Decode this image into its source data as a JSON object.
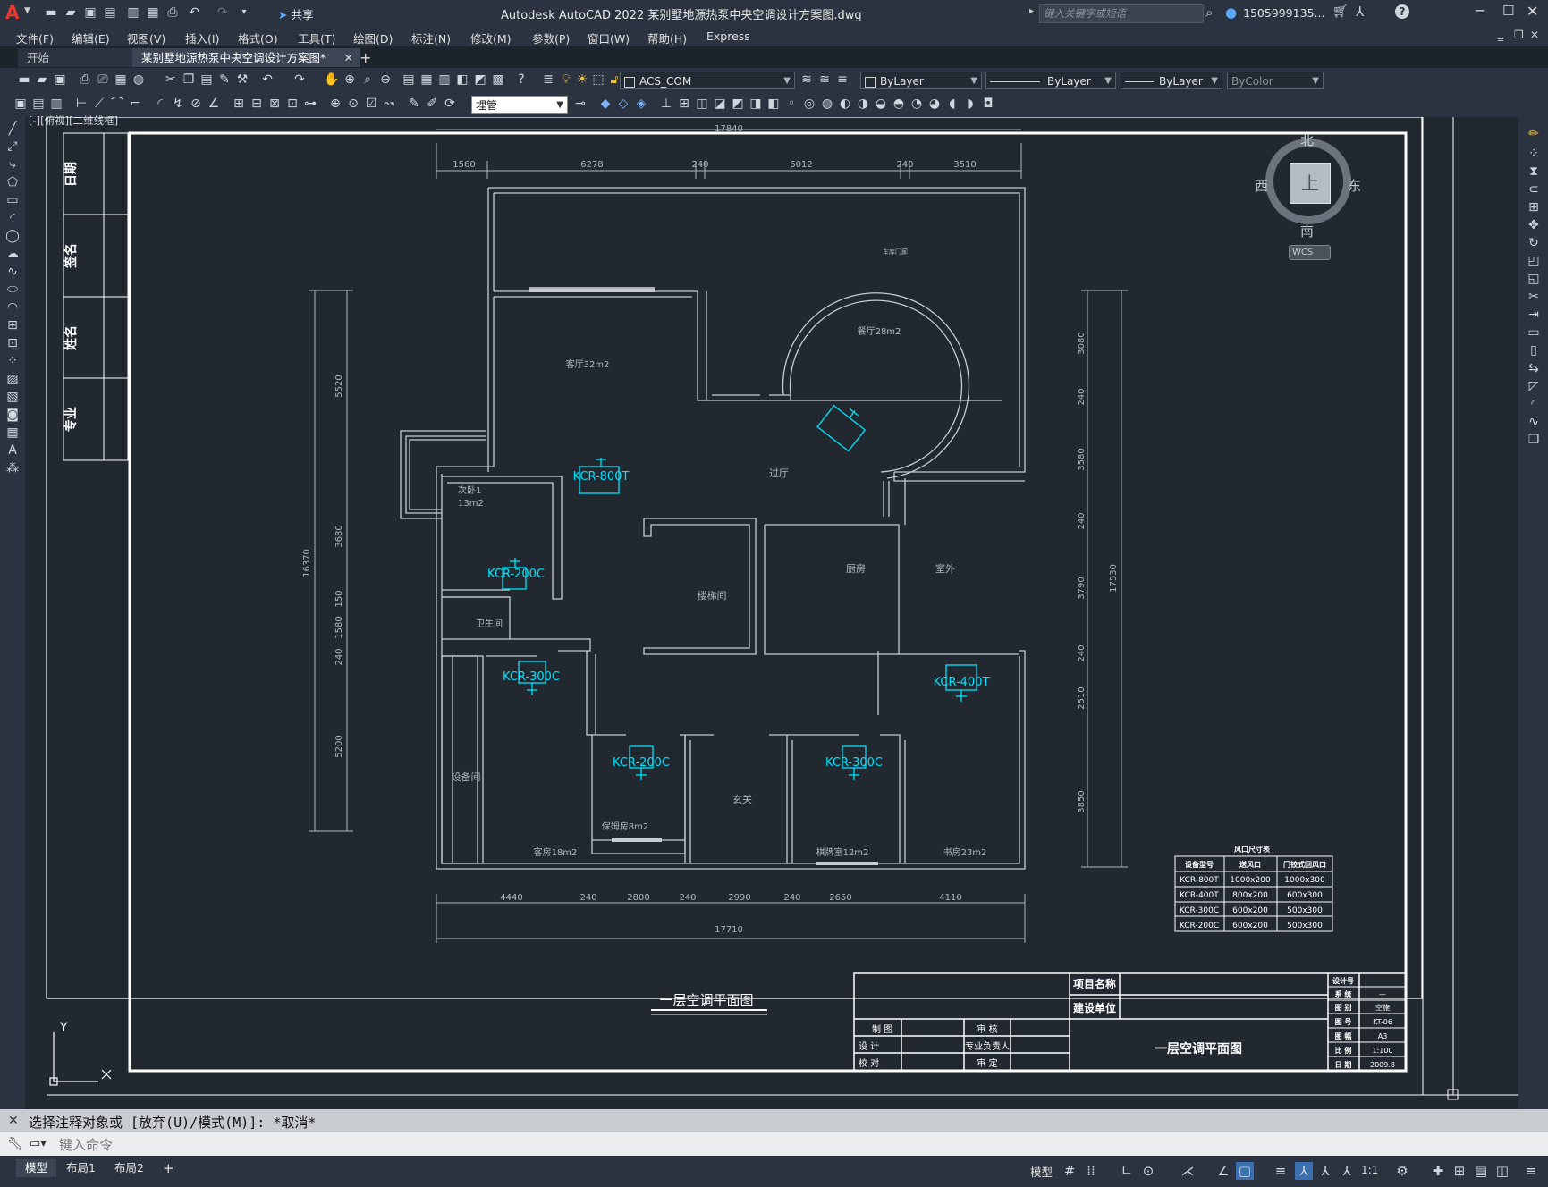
{
  "app": {
    "logo": "A",
    "title": "Autodesk AutoCAD 2022    某别墅地源热泵中央空调设计方案图.dwg",
    "search_placeholder": "键入关键字或短语",
    "user": "1505999135...",
    "share": "共享"
  },
  "menu": [
    "文件(F)",
    "编辑(E)",
    "视图(V)",
    "插入(I)",
    "格式(O)",
    "工具(T)",
    "绘图(D)",
    "标注(N)",
    "修改(M)",
    "参数(P)",
    "窗口(W)",
    "帮助(H)",
    "Express"
  ],
  "tabs": [
    {
      "label": "开始"
    },
    {
      "label": "某别墅地源热泵中央空调设计方案图*"
    }
  ],
  "toolbar": {
    "layer_value": "ACS_COM",
    "color_value": "ByLayer",
    "linetype_value": "ByLayer",
    "lineweight_value": "ByLayer",
    "plotstyle_value": "ByColor",
    "layer_filter_value": "埋管"
  },
  "viewport_label": "[-][俯视][二维线框]",
  "viewcube": {
    "north": "北",
    "south": "南",
    "east": "东",
    "west": "西",
    "top": "上",
    "wcs": "WCS"
  },
  "drawing": {
    "title": "一层空调平面图",
    "left_strip": [
      "日期",
      "签名",
      "姓名",
      "专业"
    ],
    "dims_top_total": "17840",
    "dims_top": [
      "1560",
      "6278",
      "240",
      "6012",
      "240",
      "3510"
    ],
    "dims_bottom": [
      "4440",
      "240",
      "2800",
      "240",
      "2990",
      "240",
      "2650",
      "4110"
    ],
    "dims_bottom_total": "17710",
    "dims_left": [
      "5520",
      "3680",
      "150",
      "1580",
      "240",
      "5200"
    ],
    "dims_left_total": "16370",
    "dims_right": [
      "3080",
      "240",
      "3580",
      "240",
      "3790",
      "240",
      "2510",
      "3850"
    ],
    "dims_right_total": "17530",
    "rooms": [
      {
        "label": "客厅32m2"
      },
      {
        "label": "餐厅28m2"
      },
      {
        "label": "过厅"
      },
      {
        "label": "次卧1"
      },
      {
        "label": "13m2"
      },
      {
        "label": "卫生间"
      },
      {
        "label": "楼梯间"
      },
      {
        "label": "厨房"
      },
      {
        "label": "室外"
      },
      {
        "label": "设备间"
      },
      {
        "label": "客房18m2"
      },
      {
        "label": "保姆房8m2"
      },
      {
        "label": "玄关"
      },
      {
        "label": "棋牌室12m2"
      },
      {
        "label": "书房23m2"
      },
      {
        "label": "车库门廊"
      }
    ],
    "units": [
      "KCR-800T",
      "KCR-200C",
      "KCR-300C",
      "KCR-200C",
      "KCR-300C",
      "KCR-400T"
    ],
    "table": {
      "title": "风口尺寸表",
      "headers": [
        "设备型号",
        "送风口",
        "门铰式回风口"
      ],
      "rows": [
        [
          "KCR-800T",
          "1000x200",
          "1000x300"
        ],
        [
          "KCR-400T",
          "800x200",
          "600x300"
        ],
        [
          "KCR-300C",
          "600x200",
          "500x300"
        ],
        [
          "KCR-200C",
          "600x200",
          "500x300"
        ]
      ]
    },
    "titleblock": {
      "project_name": "项目名称",
      "client": "建设单位",
      "drawn": "制  图",
      "design": "设  计",
      "check": "校  对",
      "review": "审  核",
      "lead": "专业负责人",
      "approve": "审  定",
      "big_title": "一层空调平面图",
      "right_labels": [
        "设计号",
        "系  统",
        "图  别",
        "图  号",
        "图  幅",
        "比  例",
        "日  期"
      ],
      "right_values": [
        "",
        "—",
        "空施",
        "KT-06",
        "A3",
        "1:100",
        "2009.8"
      ]
    }
  },
  "command": {
    "history": "选择注释对象或 [放弃(U)/模式(M)]: *取消*",
    "placeholder": "键入命令"
  },
  "layout_tabs": [
    "模型",
    "布局1",
    "布局2"
  ],
  "status": {
    "model": "模型",
    "scale": "1:1"
  }
}
